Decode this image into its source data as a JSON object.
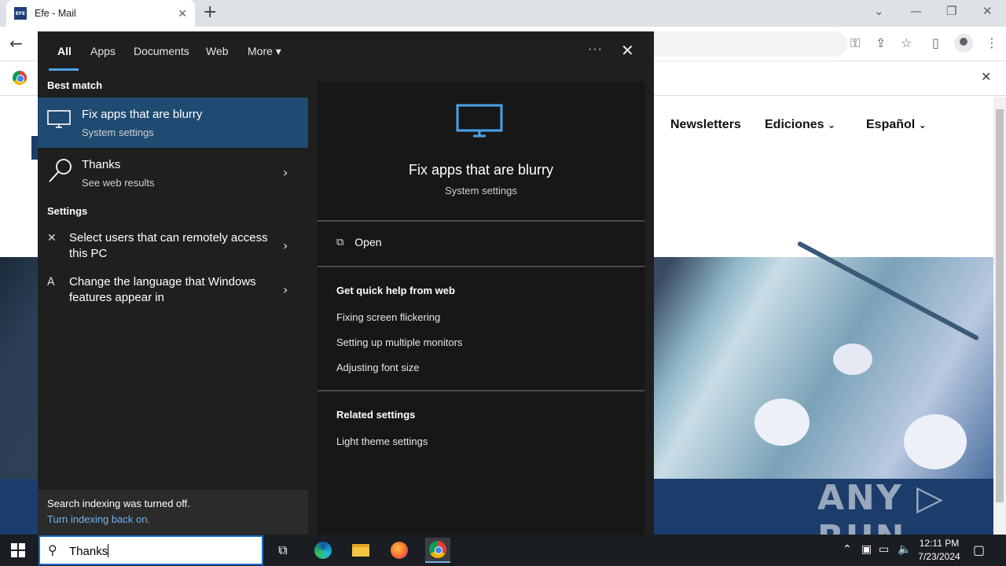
{
  "browser": {
    "tab_title": "Efe - Mail",
    "tab_favicon_text": "EFE",
    "new_tab_symbol": "+",
    "tab_close_symbol": "✕",
    "back_symbol": "←",
    "infobar_close_symbol": "✕"
  },
  "site": {
    "nav": [
      "Newsletters",
      "Ediciones",
      "Español"
    ],
    "watermark": "ANY ▷ RUN"
  },
  "search": {
    "tabs": [
      "All",
      "Apps",
      "Documents",
      "Web",
      "More"
    ],
    "more_caret": "▾",
    "dots": "···",
    "close_symbol": "✕",
    "best_match_heading": "Best match",
    "best_match": {
      "title": "Fix apps that are blurry",
      "subtitle": "System settings"
    },
    "web_result": {
      "title": "Thanks",
      "subtitle": "See web results"
    },
    "settings_heading": "Settings",
    "settings": [
      {
        "label": "Select users that can remotely access this PC",
        "icon": "remote-icon"
      },
      {
        "label": "Change the language that Windows features appear in",
        "icon": "language-icon"
      }
    ],
    "indexing_message": "Search indexing was turned off.",
    "indexing_link": "Turn indexing back on.",
    "preview": {
      "title": "Fix apps that are blurry",
      "subtitle": "System settings",
      "open_label": "Open",
      "quick_help_heading": "Get quick help from web",
      "quick_help_links": [
        "Fixing screen flickering",
        "Setting up multiple monitors",
        "Adjusting font size"
      ],
      "related_heading": "Related settings",
      "related_links": [
        "Light theme settings"
      ]
    },
    "accent_color": "#4aa3e8",
    "selected_color": "#1f4a72"
  },
  "taskbar": {
    "search_query": "Thanks",
    "clock_time": "12:11 PM",
    "clock_date": "7/23/2024"
  }
}
